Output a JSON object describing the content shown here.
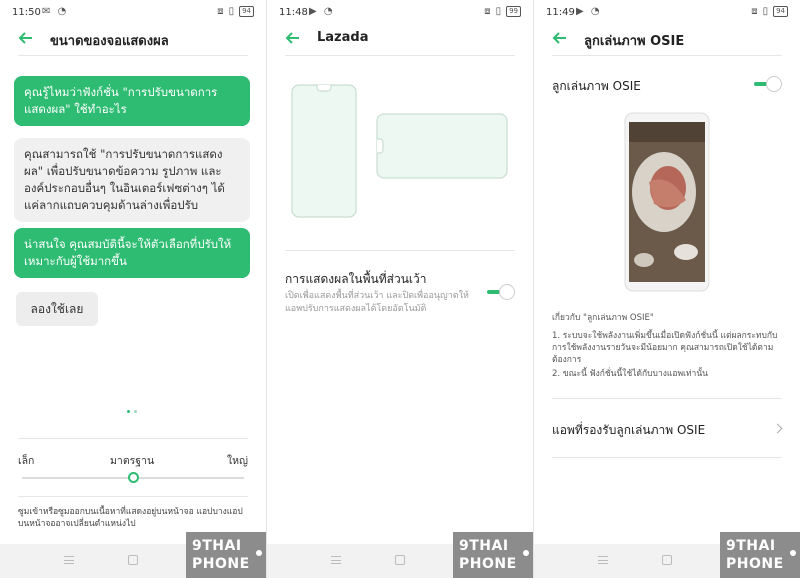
{
  "colors": {
    "accent": "#2ebb72",
    "bubble_grey": "#f0f0f0",
    "watermark": "#8c8c8c"
  },
  "screen1": {
    "status": {
      "time": "11:50",
      "battery": "94"
    },
    "title": "ขนาดของจอแสดงผล",
    "bubbles": [
      "คุณรู้ไหมว่าฟังก์ชั่น \"การปรับขนาดการแสดงผล\" ใช้ทำอะไร",
      "คุณสามารถใช้ \"การปรับขนาดการแสดงผล\" เพื่อปรับขนาดข้อความ รูปภาพ และองค์ประกอบอื่นๆ ในอินเตอร์เฟซต่างๆ ได้ แค่ลากแถบควบคุมด้านล่างเพื่อปรับ",
      "น่าสนใจ คุณสมบัตินี้จะให้ตัวเลือกที่ปรับให้เหมาะกับผู้ใช้มากขึ้น"
    ],
    "try_button": "ลองใช้เลย",
    "scale": {
      "small": "เล็ก",
      "standard": "มาตรฐาน",
      "large": "ใหญ่",
      "level": 0.5
    },
    "note": "ซูมเข้าหรือซูมออกบนเนื้อหาที่แสดงอยู่บนหน้าจอ แอปบางแอปบนหน้าจออาจเปลี่ยนตำแหน่งไป"
  },
  "screen2": {
    "status": {
      "time": "11:48",
      "battery": "99"
    },
    "title": "Lazada",
    "setting_title": "การแสดงผลในพื้นที่ส่วนเว้า",
    "setting_desc": "เปิดเพื่อแสดงพื้นที่ส่วนเว้า และปิดเพื่ออนุญาตให้แอพปรับการแสดงผลได้โดยอัตโนมัติ",
    "toggle_on": true
  },
  "screen3": {
    "status": {
      "time": "11:49",
      "battery": "94"
    },
    "title": "ลูกเล่นภาพ OSIE",
    "setting_title": "ลูกเล่นภาพ OSIE",
    "toggle_on": true,
    "about_title": "เกี่ยวกับ \"ลูกเล่นภาพ OSIE\"",
    "about_1": "1. ระบบจะใช้พลังงานเพิ่มขึ้นเมื่อเปิดฟังก์ชั่นนี้ แต่ผลกระทบกับการใช้พลังงานรายวันจะมีน้อยมาก คุณสามารถเปิดใช้ได้ตามต้องการ",
    "about_2": "2. ขณะนี้ ฟังก์ชั่นนี้ใช้ได้กับบางแอพเท่านั้น",
    "supported_apps": "แอพที่รองรับลูกเล่นภาพ OSIE"
  },
  "watermark": {
    "line1": "9THAI",
    "line2": "PHONE"
  }
}
